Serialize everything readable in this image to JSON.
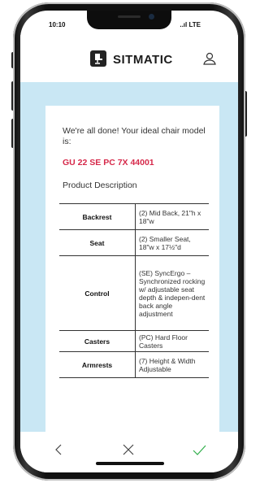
{
  "status": {
    "time": "10:10",
    "signal": "..ıl LTE"
  },
  "header": {
    "brand": "SITMATIC",
    "logo_icon": "chair-logo-icon",
    "account_icon": "user-icon"
  },
  "result": {
    "intro": "We're all done! Your ideal chair model is:",
    "model": "GU 22 SE PC 7X 44001",
    "description_label": "Product Description"
  },
  "spec_table": [
    {
      "name": "Backrest",
      "value": "(2) Mid Back, 21\"h x 18\"w"
    },
    {
      "name": "Seat",
      "value": "(2) Smaller Seat, 18\"w x 17½\"d"
    },
    {
      "name": "Control",
      "value": "(SE) SyncErgo – Synchronized rocking w/ adjustable seat depth & indepen-dent back angle adjustment"
    },
    {
      "name": "Casters",
      "value": "(PC) Hard Floor Casters"
    },
    {
      "name": "Armrests",
      "value": "(7) Height & Width Adjustable"
    }
  ],
  "nav": {
    "back_icon": "chevron-left-icon",
    "close_icon": "close-icon",
    "confirm_icon": "check-icon"
  },
  "colors": {
    "accent": "#d6294a",
    "content_bg": "#c9e7f4",
    "check": "#2fae4a"
  }
}
